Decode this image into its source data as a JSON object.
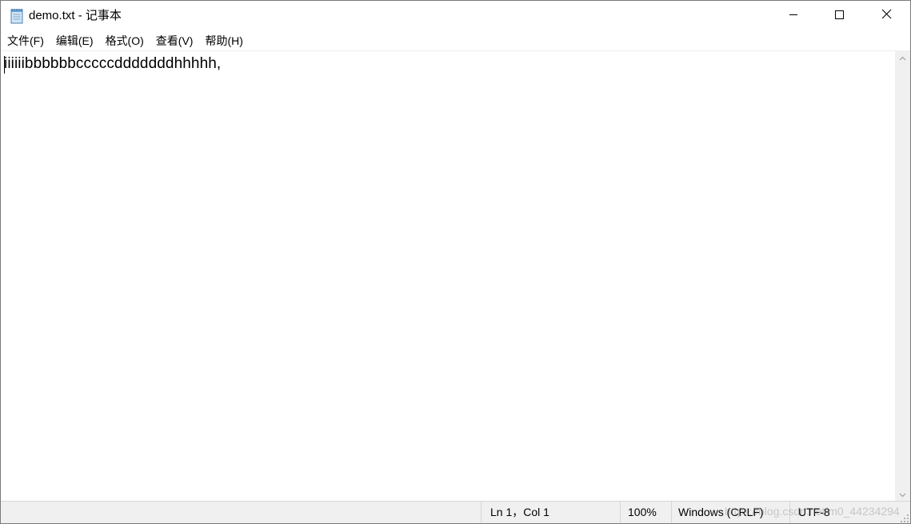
{
  "window": {
    "title": "demo.txt - 记事本"
  },
  "menu": {
    "items": [
      "文件(F)",
      "编辑(E)",
      "格式(O)",
      "查看(V)",
      "帮助(H)"
    ]
  },
  "editor": {
    "content": "iiiiiibbbbbbcccccdddddddhhhhh,"
  },
  "statusbar": {
    "position": "Ln 1，Col 1",
    "zoom": "100%",
    "line_ending": "Windows (CRLF)",
    "encoding": "UTF-8"
  },
  "watermark": {
    "text": "https://blog.csdn.net/m0_44234294"
  },
  "icons": {
    "app": "notepad-icon",
    "minimize": "minimize-icon",
    "maximize": "maximize-icon",
    "close": "close-icon",
    "scroll_up": "chevron-up-icon",
    "scroll_down": "chevron-down-icon",
    "grip": "resize-grip-icon"
  },
  "colors": {
    "statusbar_bg": "#f0f0f0",
    "scrollbar_bg": "#f0f0f0",
    "window_border": "#7a7a7a"
  }
}
